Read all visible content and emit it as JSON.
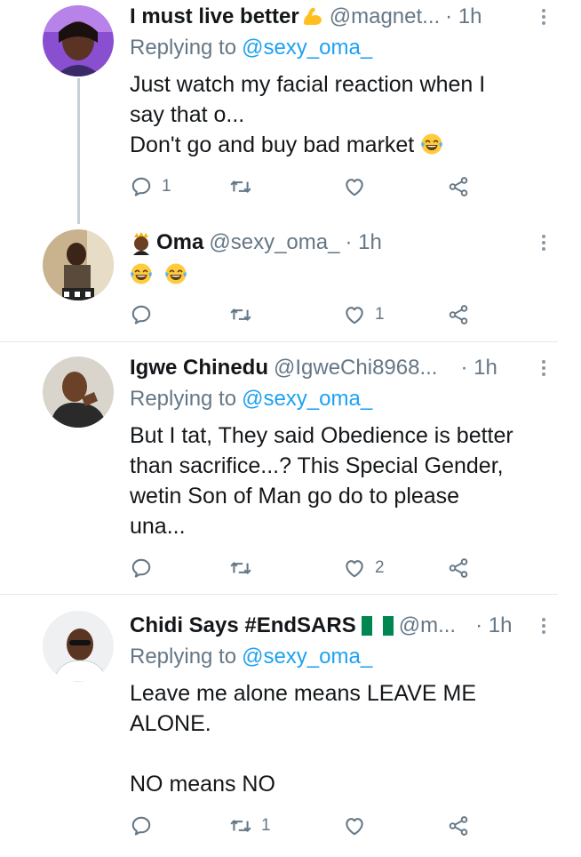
{
  "tweets": [
    {
      "name": "I must live better",
      "name_emoji": "flexed-biceps-icon",
      "handle": "@magnet...",
      "time": "· 1h",
      "replying_label": "Replying to",
      "replying_to": "@sexy_oma_",
      "body": [
        "Just watch my facial reaction when I",
        "say that o...",
        "Don't go and buy bad market"
      ],
      "body_trailing_emoji": "face-with-tears-of-joy-icon",
      "reply_count": "1",
      "retweet_count": "",
      "like_count": ""
    },
    {
      "name": "Oma",
      "name_emoji": "princess-icon",
      "handle": "@sexy_oma_",
      "time": "· 1h",
      "body_emojis": [
        "face-with-tears-of-joy-icon",
        "face-with-tears-of-joy-icon"
      ],
      "reply_count": "",
      "retweet_count": "",
      "like_count": "1"
    },
    {
      "name": "Igwe Chinedu",
      "handle": "@IgweChi8968...",
      "time": "· 1h",
      "replying_label": "Replying to",
      "replying_to": "@sexy_oma_",
      "body": [
        "But I tat, They said Obedience is better",
        "than sacrifice...? This Special Gender,",
        "wetin Son of Man go do to please",
        "una..."
      ],
      "reply_count": "",
      "retweet_count": "",
      "like_count": "2"
    },
    {
      "name": "Chidi Says #EndSARS",
      "name_emoji": "nigeria-flag-icon",
      "handle": "@m...",
      "time": "· 1h",
      "replying_label": "Replying to",
      "replying_to": "@sexy_oma_",
      "body": [
        "Leave me alone means LEAVE ME",
        "ALONE.",
        "",
        "NO means NO"
      ],
      "reply_count": "",
      "retweet_count": "1",
      "like_count": ""
    }
  ],
  "colors": {
    "text": "#14171a",
    "secondary": "#657786",
    "link": "#1da1f2",
    "divider": "#e1e8ed",
    "thread_line": "#c4cfd6",
    "flag_green": "#008751"
  }
}
